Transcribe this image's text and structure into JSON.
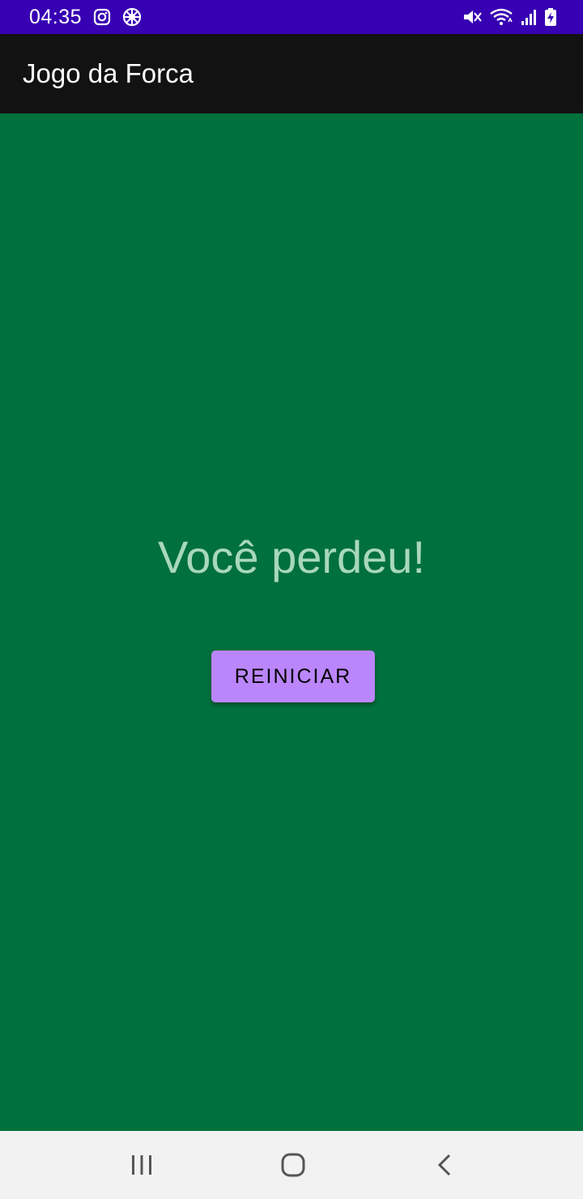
{
  "status_bar": {
    "time": "04:35",
    "icons": [
      "instagram-icon",
      "settings-wheel-icon",
      "mute-icon",
      "wifi-icon",
      "signal-icon",
      "battery-charging-icon"
    ]
  },
  "app_bar": {
    "title": "Jogo da Forca"
  },
  "main": {
    "result_message": "Você perdeu!",
    "restart_label": "REINICIAR"
  },
  "nav_bar": {
    "icons": [
      "recent-apps-icon",
      "home-icon",
      "back-icon"
    ]
  },
  "colors": {
    "status_bar": "#3700B3",
    "app_bar": "#121212",
    "background": "#00703C",
    "result_text": "#A8D8BC",
    "button": "#BB86FC",
    "nav_bar": "#F2F2F2"
  }
}
